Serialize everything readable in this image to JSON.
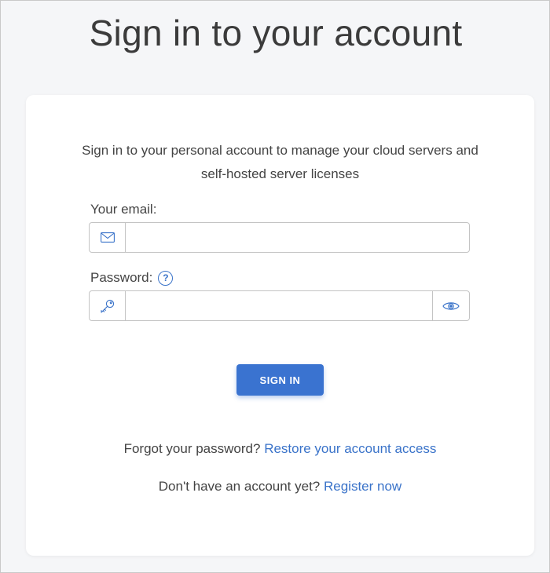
{
  "page": {
    "title": "Sign in to your account"
  },
  "card": {
    "subtitle": "Sign in to your personal account to manage your cloud servers and self-hosted server licenses"
  },
  "email": {
    "label": "Your email:",
    "value": "",
    "placeholder": "",
    "icon": "envelope-icon"
  },
  "password": {
    "label": "Password:",
    "help": "?",
    "value": "",
    "placeholder": "",
    "icon": "key-icon",
    "toggle_icon": "eye-icon"
  },
  "signin": {
    "label": "SIGN IN"
  },
  "forgot": {
    "text": "Forgot your password?",
    "link": "Restore your account access"
  },
  "register": {
    "text": "Don't have an account yet?",
    "link": "Register now"
  },
  "colors": {
    "accent": "#3a73d0",
    "link": "#3a73c9",
    "background": "#f5f6f8",
    "card": "#ffffff"
  }
}
